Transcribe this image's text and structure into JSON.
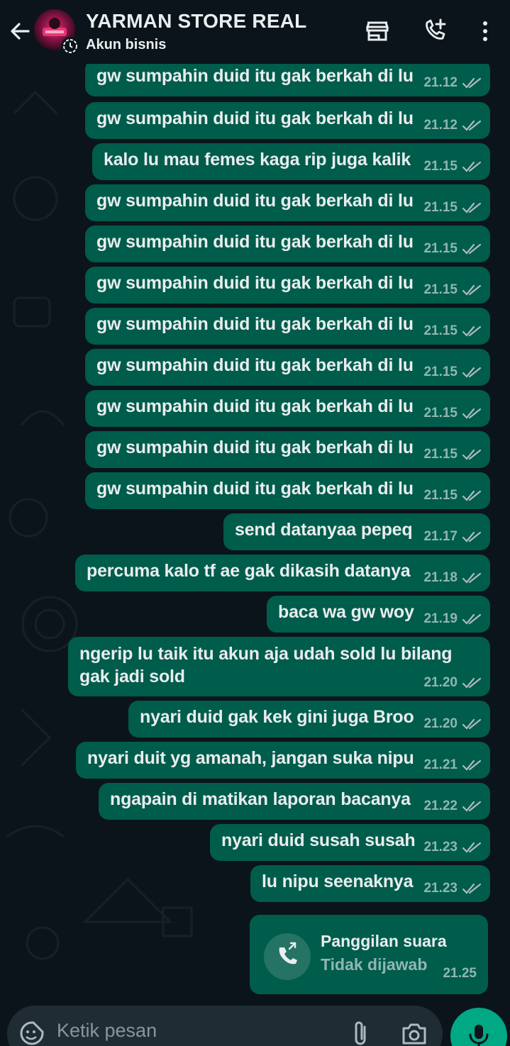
{
  "header": {
    "title": "YARMAN STORE REAL",
    "subtitle": "Akun bisnis",
    "icons": [
      "back-arrow-icon",
      "storefront-icon",
      "add-call-icon",
      "more-vert-icon"
    ]
  },
  "messages": [
    {
      "text": "gw sumpahin duid itu gak berkah di lu",
      "time": "21.12"
    },
    {
      "text": "gw sumpahin duid itu gak berkah di lu",
      "time": "21.12"
    },
    {
      "text": "kalo lu mau femes kaga rip juga kalik",
      "time": "21.15"
    },
    {
      "text": "gw sumpahin duid itu gak berkah di lu",
      "time": "21.15"
    },
    {
      "text": "gw sumpahin duid itu gak berkah di lu",
      "time": "21.15"
    },
    {
      "text": "gw sumpahin duid itu gak berkah di lu",
      "time": "21.15"
    },
    {
      "text": "gw sumpahin duid itu gak berkah di lu",
      "time": "21.15"
    },
    {
      "text": "gw sumpahin duid itu gak berkah di lu",
      "time": "21.15"
    },
    {
      "text": "gw sumpahin duid itu gak berkah di lu",
      "time": "21.15"
    },
    {
      "text": "gw sumpahin duid itu gak berkah di lu",
      "time": "21.15"
    },
    {
      "text": "gw sumpahin duid itu gak berkah di lu",
      "time": "21.15"
    },
    {
      "text": "send datanyaa pepeq",
      "time": "21.17"
    },
    {
      "text": "percuma kalo tf ae gak dikasih datanya",
      "time": "21.18"
    },
    {
      "text": "baca wa gw woy",
      "time": "21.19"
    },
    {
      "text": "ngerip lu taik itu akun aja udah sold lu bilang gak jadi sold",
      "time": "21.20"
    },
    {
      "text": "nyari duid gak kek gini juga Broo",
      "time": "21.20"
    },
    {
      "text": "nyari duit yg amanah, jangan suka nipu",
      "time": "21.21"
    },
    {
      "text": "ngapain di matikan laporan bacanya",
      "time": "21.22"
    },
    {
      "text": "nyari duid susah susah",
      "time": "21.23"
    },
    {
      "text": "lu nipu seenaknya",
      "time": "21.23"
    }
  ],
  "call": {
    "title": "Panggilan suara",
    "status": "Tidak dijawab",
    "time": "21.25"
  },
  "composer": {
    "placeholder": "Ketik pesan"
  },
  "colors": {
    "background": "#0b141a",
    "outgoing_bubble": "#005c4b",
    "input_bar": "#1f2c34",
    "send_button": "#00a884"
  }
}
